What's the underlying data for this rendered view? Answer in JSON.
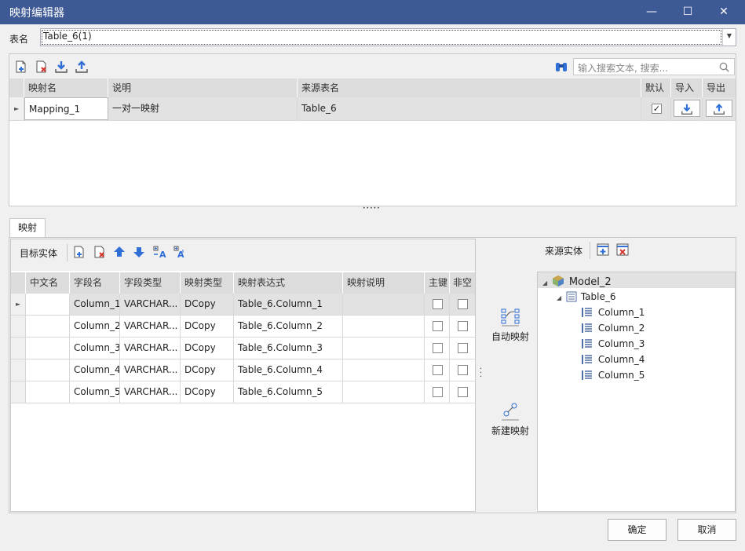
{
  "window": {
    "title": "映射编辑器",
    "minimize": "—",
    "maximize": "☐",
    "close": "✕"
  },
  "table_name": {
    "label": "表名",
    "value": "Table_6(1)"
  },
  "top_panel": {
    "search_placeholder": "输入搜索文本, 搜索...",
    "columns": [
      "映射名",
      "说明",
      "来源表名",
      "默认",
      "导入",
      "导出"
    ],
    "rows": [
      {
        "name": "Mapping_1",
        "description": "一对一映射",
        "source_table": "Table_6",
        "default": true
      }
    ]
  },
  "splitter": "•••••",
  "tabs": {
    "mapping": "映射"
  },
  "target": {
    "label": "目标实体",
    "columns": [
      "中文名",
      "字段名",
      "字段类型",
      "映射类型",
      "映射表达式",
      "映射说明",
      "主键",
      "非空"
    ],
    "rows": [
      {
        "cn": "",
        "field": "Column_1",
        "type": "VARCHAR...",
        "map_type": "DCopy",
        "expr": "Table_6.Column_1",
        "desc": "",
        "pk": false,
        "nn": false
      },
      {
        "cn": "",
        "field": "Column_2",
        "type": "VARCHAR...",
        "map_type": "DCopy",
        "expr": "Table_6.Column_2",
        "desc": "",
        "pk": false,
        "nn": false
      },
      {
        "cn": "",
        "field": "Column_3",
        "type": "VARCHAR...",
        "map_type": "DCopy",
        "expr": "Table_6.Column_3",
        "desc": "",
        "pk": false,
        "nn": false
      },
      {
        "cn": "",
        "field": "Column_4",
        "type": "VARCHAR...",
        "map_type": "DCopy",
        "expr": "Table_6.Column_4",
        "desc": "",
        "pk": false,
        "nn": false
      },
      {
        "cn": "",
        "field": "Column_5",
        "type": "VARCHAR...",
        "map_type": "DCopy",
        "expr": "Table_6.Column_5",
        "desc": "",
        "pk": false,
        "nn": false
      }
    ]
  },
  "middle": {
    "auto_map": "自动映射",
    "new_map": "新建映射"
  },
  "source": {
    "label": "来源实体",
    "model": "Model_2",
    "table": "Table_6",
    "columns": [
      "Column_1",
      "Column_2",
      "Column_3",
      "Column_4",
      "Column_5"
    ]
  },
  "footer": {
    "ok": "确定",
    "cancel": "取消"
  },
  "colors": {
    "titlebar": "#3d5a96",
    "accent_blue": "#2f6fd6",
    "delete_red": "#d9342b"
  }
}
